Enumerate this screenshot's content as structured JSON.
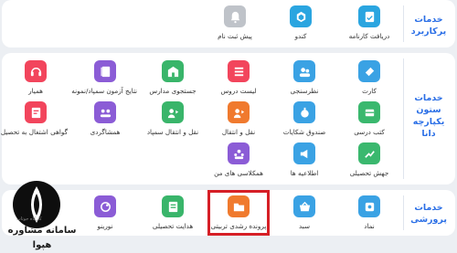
{
  "sections": [
    {
      "title": "خدمات پرکاربرد",
      "tiles": [
        {
          "label": "دریافت کارنامه",
          "icon": "report-card-icon",
          "color": "#2aa5e0"
        },
        {
          "label": "کندو",
          "icon": "beehive-icon",
          "color": "#2aa5e0"
        },
        {
          "label": "پیش ثبت نام",
          "icon": "bell-icon",
          "color": "#bfc3c9"
        }
      ]
    },
    {
      "title": "خدمات ستون یکپارچه دانا",
      "rows": [
        [
          {
            "label": "کارت",
            "icon": "card-icon",
            "color": "#3aa2e4"
          },
          {
            "label": "نظرسنجی",
            "icon": "survey-icon",
            "color": "#3aa2e4"
          },
          {
            "label": "لیست دروس",
            "icon": "list-icon",
            "color": "#f2455c"
          },
          {
            "label": "جستجوی مدارس",
            "icon": "school-search-icon",
            "color": "#39b56a"
          },
          {
            "label": "نتایج آزمون سمپاد/نمونه",
            "icon": "exam-results-icon",
            "color": "#8b5cd6"
          },
          {
            "label": "همیار",
            "icon": "headset-icon",
            "color": "#f2455c"
          }
        ],
        [
          {
            "label": "کتب درسی",
            "icon": "books-icon",
            "color": "#3ab86e"
          },
          {
            "label": "صندوق شکایات",
            "icon": "complaint-box-icon",
            "color": "#3aa2e4"
          },
          {
            "label": "نقل و انتقال",
            "icon": "transfer-icon",
            "color": "#f07a2e"
          },
          {
            "label": "نقل و انتقال سمپاد",
            "icon": "transfer-samped-icon",
            "color": "#39b56a"
          },
          {
            "label": "همشاگردی",
            "icon": "classmates-icon",
            "color": "#8b5cd6"
          },
          {
            "label": "گواهی اشتغال به تحصیل",
            "icon": "certificate-icon",
            "color": "#f2455c"
          }
        ],
        [
          {
            "label": "جهش تحصیلی",
            "icon": "education-leap-icon",
            "color": "#3ab86e"
          },
          {
            "label": "اطلاعیه ها",
            "icon": "announcements-icon",
            "color": "#3aa2e4"
          },
          {
            "label": "همکلاسی های من",
            "icon": "my-classmates-icon",
            "color": "#8b5cd6"
          }
        ]
      ]
    },
    {
      "title": "خدمات پرورشی",
      "tiles": [
        {
          "label": "نماد",
          "icon": "symbol-icon",
          "color": "#3aa2e4"
        },
        {
          "label": "سبد",
          "icon": "basket-icon",
          "color": "#3aa2e4"
        },
        {
          "label": "پرونده رشدی تربیتی",
          "icon": "growth-file-icon",
          "color": "#f07a2e"
        },
        {
          "label": "هدایت تحصیلی",
          "icon": "guidance-icon",
          "color": "#39b56a"
        },
        {
          "label": "نورینو",
          "icon": "norino-icon",
          "color": "#8b5cd6"
        }
      ]
    }
  ],
  "watermark": {
    "text": "سامانه مشاوره هپوا",
    "subtext": "کارکاه",
    "subtext2": "جوتاب"
  }
}
